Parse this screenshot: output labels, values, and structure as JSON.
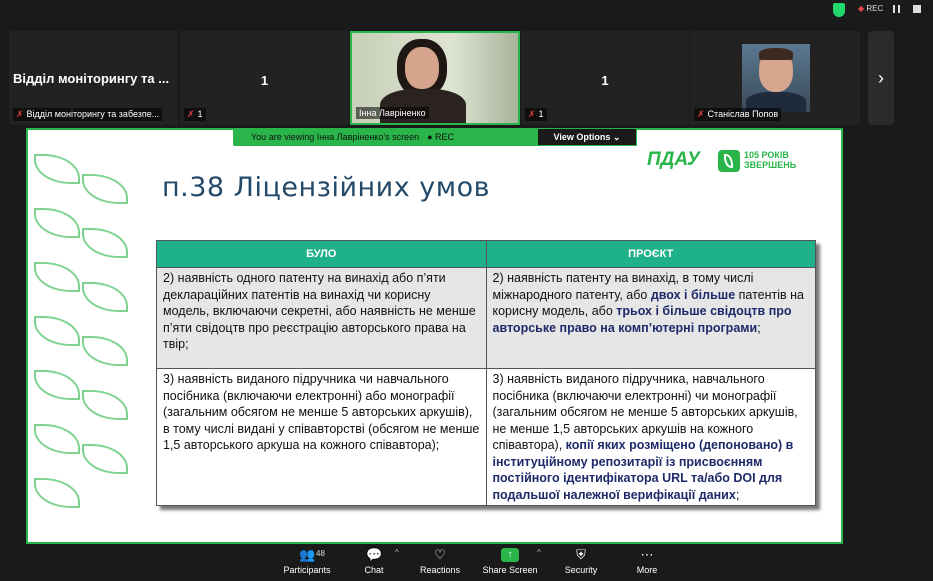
{
  "topbar": {
    "rec_label": "REC"
  },
  "tiles": [
    {
      "title": "Відділ моніторингу та ...",
      "name": "Відділ моніторингу та забезпе..."
    },
    {
      "number": "1",
      "name": "1"
    },
    {
      "name": "Інна Лавріненко"
    },
    {
      "number": "1",
      "name": "1"
    },
    {
      "name": "Станіслав Попов"
    }
  ],
  "share_banner": {
    "text": "You are viewing Інна Лавріненко's screen",
    "rec": "REC",
    "view_options": "View Options"
  },
  "slide": {
    "title": "п.38 Ліцензійних умов",
    "logo_text": "ПДАУ",
    "logo_sub_1": "105 РОКІВ",
    "logo_sub_2": "ЗВЕРШЕНЬ",
    "table": {
      "headers": [
        "БУЛО",
        "ПРОЄКТ"
      ],
      "row1": {
        "left": "2) наявність одного патенту на винахід або п’яти декларацій­них патентів на винахід чи корисну модель, включаючи секретні, або наявність не менше п’яти свідоцтв про реєстрацію авторського права на твір;",
        "right_a": "2) наявність патенту на винахід, в тому числі міжнародного патенту, або ",
        "right_b": "двох і більше",
        "right_c": " патентів на корисну модель, або ",
        "right_d": "трьох і більше свідоцтв про авторське право на комп’ютерні програми",
        "right_e": ";"
      },
      "row2": {
        "left": "3) наявність виданого підручника чи навчального посібника (включаючи електронні) або монографії (загальним обсягом не менше 5 авторських аркушів), в тому числі видані у співавторстві (обсягом не менше 1,5 авторського аркуша на кожного співавтора);",
        "right_a": "3) наявність виданого підручника, навчального посібника (включаючи електронні) чи монографії (загальним обсягом не менше 5 авторських аркушів, не менше 1,5 авторських аркушів на кожного співавтора), ",
        "right_b": "копії яких розміщено (депоновано) в інституційному репозитарії із присвоєнням постійного ідентифікатора URL та/або DOI для подальшої належної верифікації даних",
        "right_c": ";"
      }
    }
  },
  "toolbar": {
    "participants_count": "48",
    "participants": "Participants",
    "chat": "Chat",
    "reactions": "Reactions",
    "share": "Share Screen",
    "security": "Security",
    "more": "More"
  }
}
